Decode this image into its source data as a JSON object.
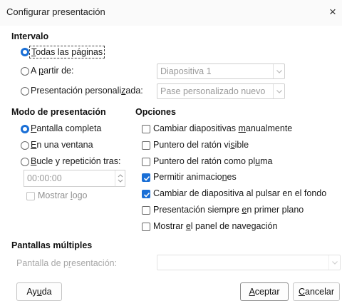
{
  "dialog": {
    "title": "Configurar presentación",
    "close_glyph": "×"
  },
  "intervalo": {
    "heading": "Intervalo",
    "todas": {
      "pre": "",
      "u": "T",
      "post": "odas las páginas",
      "checked": true
    },
    "desde": {
      "pre": "A ",
      "u": "p",
      "post": "artir de:",
      "checked": false,
      "value": "Diapositiva 1"
    },
    "personalizada": {
      "pre": "Presentación personali",
      "u": "z",
      "post": "ada:",
      "checked": false,
      "value": "Pase personalizado nuevo"
    }
  },
  "modo": {
    "heading": "Modo de presentación",
    "completa": {
      "pre": "",
      "u": "P",
      "post": "antalla completa",
      "checked": true
    },
    "ventana": {
      "pre": "",
      "u": "E",
      "post": "n una ventana",
      "checked": false
    },
    "bucle": {
      "pre": "",
      "u": "B",
      "post": "ucle y repetición tras:",
      "checked": false
    },
    "tiempo": "00:00:00",
    "logo": {
      "pre": "Mostrar ",
      "u": "l",
      "post": "ogo",
      "checked": false
    }
  },
  "opciones": {
    "heading": "Opciones",
    "items": [
      {
        "pre": "Cambiar diapositivas ",
        "u": "m",
        "post": "anualmente",
        "checked": false
      },
      {
        "pre": "Puntero del ratón vi",
        "u": "s",
        "post": "ible",
        "checked": false
      },
      {
        "pre": "Puntero del ratón como pl",
        "u": "u",
        "post": "ma",
        "checked": false
      },
      {
        "pre": "Permitir animacio",
        "u": "n",
        "post": "es",
        "checked": true
      },
      {
        "pre": "Cambiar de diapositiva al pulsar en el fondo",
        "u": "",
        "post": "",
        "checked": true
      },
      {
        "pre": "Presentación siempre ",
        "u": "e",
        "post": "n primer plano",
        "checked": false
      },
      {
        "pre": "Mostrar ",
        "u": "e",
        "post": "l panel de navegación",
        "checked": false
      }
    ]
  },
  "pantallas": {
    "heading": "Pantallas múltiples",
    "label": {
      "pre": "Pantalla de p",
      "u": "r",
      "post": "esentación:"
    },
    "value": ""
  },
  "buttons": {
    "ayuda": {
      "pre": "Ay",
      "u": "u",
      "post": "da"
    },
    "aceptar": {
      "pre": "",
      "u": "A",
      "post": "ceptar"
    },
    "cancelar": {
      "pre": "",
      "u": "C",
      "post": "ancelar"
    }
  },
  "colors": {
    "accent": "#1a6fd6",
    "disabled_text": "#8f8f8f",
    "border": "#cfcfcf"
  }
}
